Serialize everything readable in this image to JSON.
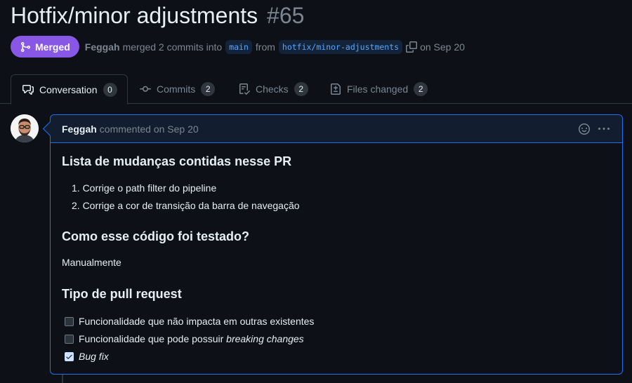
{
  "pr": {
    "title": "Hotfix/minor adjustments",
    "number": "#65",
    "status_label": "Merged",
    "author": "Feggah",
    "merged_text": "merged 2 commits into",
    "base_branch": "main",
    "from_text": "from",
    "head_branch": "hotfix/minor-adjustments",
    "date_text": "on Sep 20"
  },
  "tabs": [
    {
      "label": "Conversation",
      "count": "0",
      "icon": "comment-discussion-icon",
      "active": true
    },
    {
      "label": "Commits",
      "count": "2",
      "icon": "git-commit-icon"
    },
    {
      "label": "Checks",
      "count": "2",
      "icon": "checklist-icon"
    },
    {
      "label": "Files changed",
      "count": "2",
      "icon": "file-diff-icon"
    }
  ],
  "comment": {
    "author": "Feggah",
    "meta": "commented on Sep 20",
    "sections": {
      "changes_heading": "Lista de mudanças contidas nesse PR",
      "changes": [
        "1. Corrige o path filter do pipeline",
        "2. Corrige a cor de transição da barra de navegação"
      ],
      "tested_heading": "Como esse código foi testado?",
      "tested_text": "Manualmente",
      "type_heading": "Tipo de pull request",
      "task_1": "Funcionalidade que não impacta em outras existentes",
      "task_2_prefix": "Funcionalidade que pode possuir ",
      "task_2_em": "breaking changes",
      "task_3_em": "Bug fix"
    },
    "tasks_checked": [
      false,
      false,
      true
    ]
  },
  "colors": {
    "merged": "#8957e5",
    "accent": "#1f6feb",
    "link": "#58a6ff",
    "background": "#0d1117"
  }
}
